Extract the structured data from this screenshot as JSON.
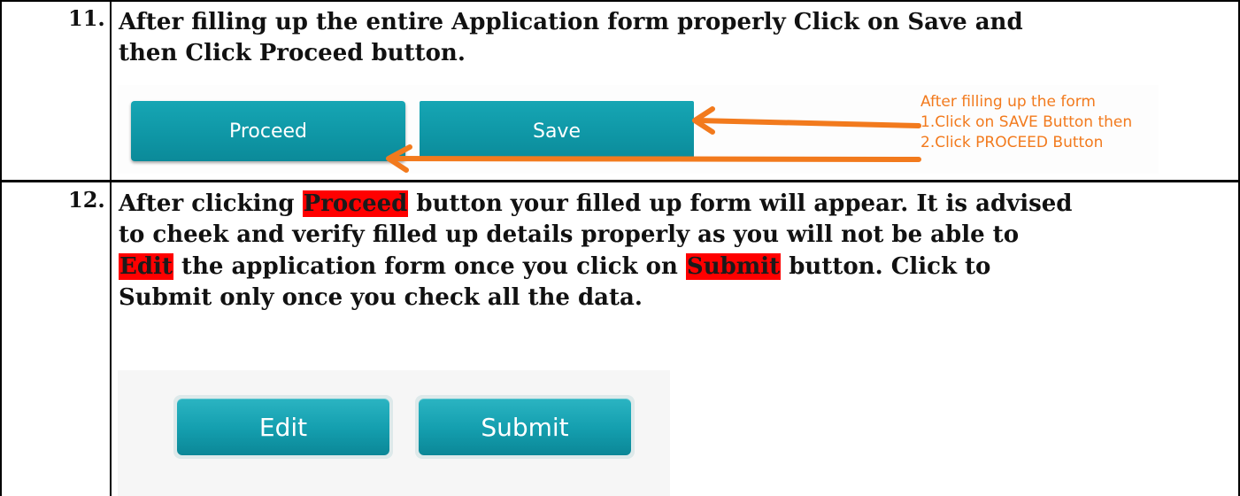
{
  "rows": [
    {
      "number": "11.",
      "instruction_lines": [
        "After filling up the entire Application form properly Click on Save and",
        "then Click Proceed button."
      ],
      "screenshot": {
        "buttons": {
          "proceed": "Proceed",
          "save": "Save"
        },
        "note_lines": [
          "After filling up the form",
          "1.Click on SAVE Button then",
          "2.Click PROCEED Button"
        ],
        "note_color": "#f27a1d",
        "arrow_color": "#f27a1d",
        "button_color": "#0f97a6"
      }
    },
    {
      "number": "12.",
      "instruction": {
        "l1_a": "After clicking ",
        "l1_hl": "Proceed",
        "l1_b": " button your filled up form will appear. It is advised",
        "l2": "to cheek and verify filled up details properly as you will not be able to",
        "l3_hl1": "Edit",
        "l3_mid": " the application form once you click on ",
        "l3_hl2": "Submit",
        "l3_b": " button. Click to",
        "l4": "Submit only once you check all the data."
      },
      "highlight_color": "#ff0000",
      "screenshot": {
        "buttons": {
          "edit": "Edit",
          "submit": "Submit"
        },
        "button_color": "#15a0b0"
      }
    }
  ]
}
